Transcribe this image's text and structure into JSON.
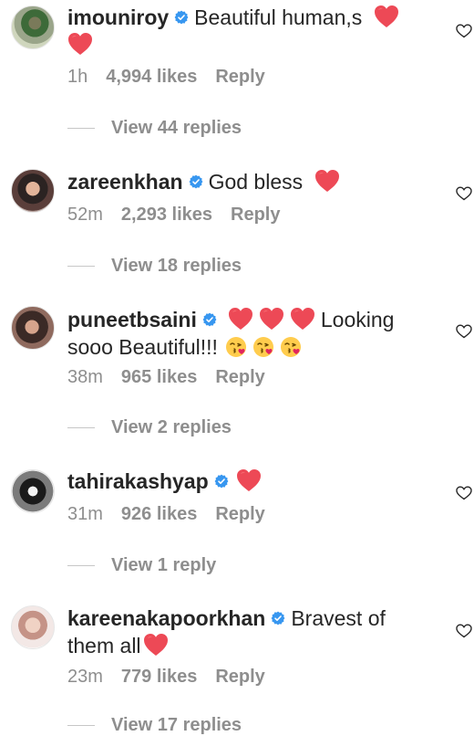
{
  "comments": [
    {
      "username": "imouniroy",
      "text": "Beautiful human,s",
      "time": "1h",
      "likes": "4,994 likes",
      "reply": "Reply",
      "view_replies": "View 44 replies"
    },
    {
      "username": "zareenkhan",
      "text": "God bless",
      "time": "52m",
      "likes": "2,293 likes",
      "reply": "Reply",
      "view_replies": "View 18 replies"
    },
    {
      "username": "puneetbsaini",
      "text": "Looking sooo Beautiful!!!",
      "time": "38m",
      "likes": "965 likes",
      "reply": "Reply",
      "view_replies": "View 2 replies"
    },
    {
      "username": "tahirakashyap",
      "text": "",
      "time": "31m",
      "likes": "926 likes",
      "reply": "Reply",
      "view_replies": "View 1 reply"
    },
    {
      "username": "kareenakapoorkhan",
      "text": "Bravest of them all",
      "time": "23m",
      "likes": "779 likes",
      "reply": "Reply",
      "view_replies": "View 17 replies"
    }
  ],
  "colors": {
    "text": "#262626",
    "meta": "#8e8e8e",
    "verified": "#3897f0",
    "heart": "#ed4956"
  },
  "icons": {
    "verified": "verified-badge-icon",
    "heart": "red-heart-emoji-icon",
    "kiss": "face-blowing-kiss-emoji-icon",
    "like": "heart-outline-icon"
  }
}
